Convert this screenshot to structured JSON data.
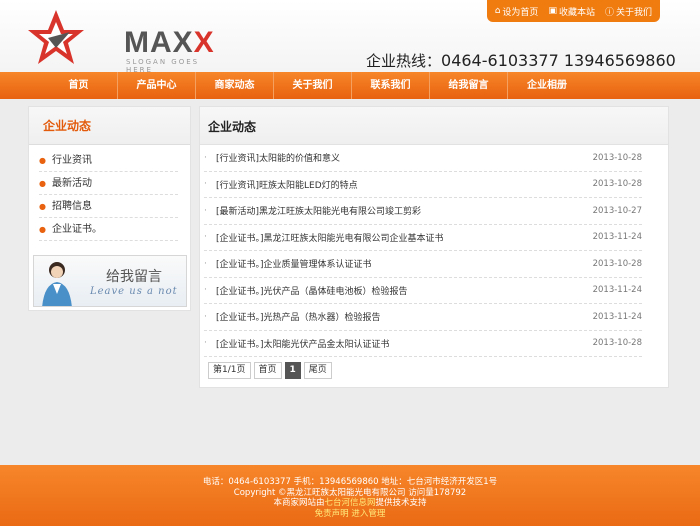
{
  "topbar": {
    "items": [
      {
        "label": "设为首页",
        "icon": "home-icon"
      },
      {
        "label": "收藏本站",
        "icon": "bookmark-icon"
      },
      {
        "label": "关于我们",
        "icon": "info-icon"
      }
    ]
  },
  "logo": {
    "text_main": "MAX",
    "text_accent": "X",
    "slogan": "SLOGAN GOES HERE"
  },
  "hotline": {
    "label": "企业热线：",
    "number": "0464-6103377 13946569860"
  },
  "nav": [
    "首页",
    "产品中心",
    "商家动态",
    "关于我们",
    "联系我们",
    "给我留言",
    "企业相册"
  ],
  "sidebar": {
    "title": "企业动态",
    "items": [
      "行业资讯",
      "最新活动",
      "招聘信息",
      "企业证书。"
    ],
    "banner": {
      "title": "给我留言",
      "subtitle": "Leave us a not"
    }
  },
  "main": {
    "title": "企业动态",
    "news": [
      {
        "title": "[行业资讯]太阳能的价值和意义",
        "date": "2013-10-28"
      },
      {
        "title": "[行业资讯]旺族太阳能LED灯的特点",
        "date": "2013-10-28"
      },
      {
        "title": "[最新活动]黑龙江旺族太阳能光电有限公司竣工剪彩",
        "date": "2013-10-27"
      },
      {
        "title": "[企业证书。]黑龙江旺族太阳能光电有限公司企业基本证书",
        "date": "2013-11-24"
      },
      {
        "title": "[企业证书。]企业质量管理体系认证证书",
        "date": "2013-10-28"
      },
      {
        "title": "[企业证书。]光伏产品（晶体硅电池板）检验报告",
        "date": "2013-11-24"
      },
      {
        "title": "[企业证书。]光热产品（热水器）检验报告",
        "date": "2013-11-24"
      },
      {
        "title": "[企业证书。]太阳能光伏产品金太阳认证证书",
        "date": "2013-10-28"
      }
    ],
    "pager": {
      "info": "第1/1页",
      "first": "首页",
      "current": "1",
      "last": "尾页"
    }
  },
  "footer": {
    "line1": "电话：0464-6103377 手机：13946569860 地址：七台河市经济开发区1号",
    "line2": "Copyright ©黑龙江旺族太阳能光电有限公司 访问量178792",
    "line3_pre": "本商家网站由",
    "line3_link": "七台河信息网",
    "line3_post": "提供技术支持",
    "line4_a": "免责声明",
    "line4_b": "进入管理"
  },
  "colors": {
    "accent": "#e8620f",
    "nav_orange": "#f7862a"
  }
}
